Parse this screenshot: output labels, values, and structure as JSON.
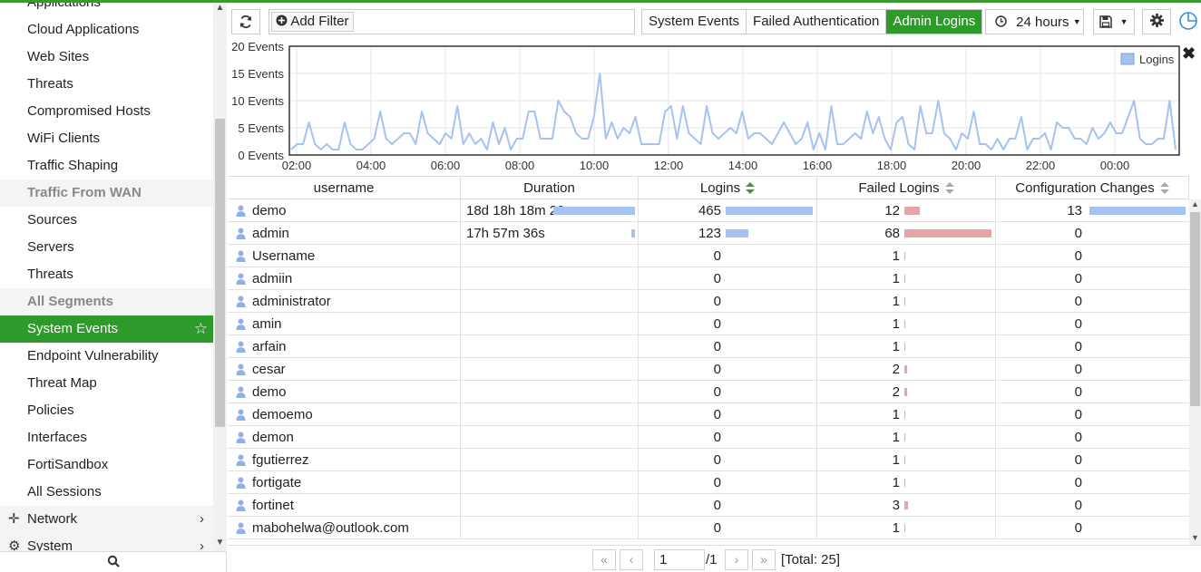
{
  "sidebar": {
    "items": [
      {
        "label": "Applications",
        "type": "item"
      },
      {
        "label": "Cloud Applications",
        "type": "item"
      },
      {
        "label": "Web Sites",
        "type": "item"
      },
      {
        "label": "Threats",
        "type": "item"
      },
      {
        "label": "Compromised Hosts",
        "type": "item"
      },
      {
        "label": "WiFi Clients",
        "type": "item"
      },
      {
        "label": "Traffic Shaping",
        "type": "item"
      },
      {
        "label": "Traffic From WAN",
        "type": "header"
      },
      {
        "label": "Sources",
        "type": "item"
      },
      {
        "label": "Servers",
        "type": "item"
      },
      {
        "label": "Threats",
        "type": "item"
      },
      {
        "label": "All Segments",
        "type": "header"
      },
      {
        "label": "System Events",
        "type": "active"
      },
      {
        "label": "Endpoint Vulnerability",
        "type": "item"
      },
      {
        "label": "Threat Map",
        "type": "item"
      },
      {
        "label": "Policies",
        "type": "item"
      },
      {
        "label": "Interfaces",
        "type": "item"
      },
      {
        "label": "FortiSandbox",
        "type": "item"
      },
      {
        "label": "All Sessions",
        "type": "item"
      }
    ],
    "network_label": "Network",
    "system_label": "System"
  },
  "toolbar": {
    "add_filter_label": "Add Filter",
    "segments": [
      {
        "label": "System Events",
        "active": false
      },
      {
        "label": "Failed Authentication",
        "active": false
      },
      {
        "label": "Admin Logins",
        "active": true
      }
    ],
    "time_range": "24 hours"
  },
  "chart_data": {
    "type": "line",
    "ylim": [
      0,
      20
    ],
    "y_ticks": [
      "0 Events",
      "5 Events",
      "10 Events",
      "15 Events",
      "20 Events"
    ],
    "x_ticks": [
      "02:00",
      "04:00",
      "06:00",
      "08:00",
      "10:00",
      "12:00",
      "14:00",
      "16:00",
      "18:00",
      "20:00",
      "22:00",
      "00:00"
    ],
    "legend": "Logins",
    "legend_position": "top-right",
    "color": "#a6c2f0",
    "series": [
      {
        "name": "Logins",
        "values": [
          1,
          2,
          2,
          6,
          2,
          1,
          2,
          1,
          1,
          6,
          2,
          1,
          1,
          2,
          3,
          8,
          3,
          2,
          3,
          4,
          4,
          2,
          8,
          4,
          3,
          2,
          4,
          3,
          9,
          2,
          4,
          2,
          3,
          1,
          6,
          2,
          5,
          1,
          3,
          3,
          8,
          8,
          3,
          3,
          3,
          10,
          8,
          7,
          4,
          3,
          3,
          7,
          15,
          3,
          6,
          3,
          5,
          4,
          7,
          2,
          2,
          2,
          2,
          8,
          9,
          3,
          9,
          4,
          3,
          2,
          9,
          4,
          3,
          4,
          5,
          4,
          8,
          3,
          4,
          4,
          3,
          2,
          4,
          6,
          4,
          2,
          3,
          6,
          1,
          4,
          1,
          9,
          2,
          2,
          3,
          4,
          3,
          8,
          4,
          7,
          3,
          1,
          6,
          7,
          2,
          1,
          9,
          4,
          4,
          10,
          4,
          3,
          1,
          4,
          3,
          8,
          2,
          2,
          1,
          3,
          1,
          3,
          3,
          7,
          1,
          3,
          3,
          4,
          1,
          6,
          5,
          5,
          3,
          3,
          2,
          5,
          3,
          4,
          6,
          4,
          4,
          7,
          10,
          3,
          2,
          2,
          3,
          3,
          10,
          1
        ]
      }
    ]
  },
  "table": {
    "columns": [
      "username",
      "Duration",
      "Logins",
      "Failed Logins",
      "Configuration Changes"
    ],
    "sorted_column": "Logins",
    "rows": [
      {
        "username": "demo",
        "duration": "18d 18h 18m 20s",
        "duration_frac": 1.0,
        "logins": "465",
        "logins_frac": 1.0,
        "failed": "12",
        "failed_frac": 0.18,
        "config": "13",
        "config_frac": 1.0
      },
      {
        "username": "admin",
        "duration": "17h 57m 36s",
        "duration_frac": 0.04,
        "logins": "123",
        "logins_frac": 0.26,
        "failed": "68",
        "failed_frac": 1.0,
        "config": "0",
        "config_frac": 0
      },
      {
        "username": "Username",
        "duration": "",
        "duration_frac": 0,
        "logins": "0",
        "logins_frac": 0,
        "failed": "1",
        "failed_frac": 0.015,
        "config": "0",
        "config_frac": 0
      },
      {
        "username": "admiin",
        "duration": "",
        "duration_frac": 0,
        "logins": "0",
        "logins_frac": 0,
        "failed": "1",
        "failed_frac": 0.015,
        "config": "0",
        "config_frac": 0
      },
      {
        "username": "administrator",
        "duration": "",
        "duration_frac": 0,
        "logins": "0",
        "logins_frac": 0,
        "failed": "1",
        "failed_frac": 0.015,
        "config": "0",
        "config_frac": 0
      },
      {
        "username": "amin",
        "duration": "",
        "duration_frac": 0,
        "logins": "0",
        "logins_frac": 0,
        "failed": "1",
        "failed_frac": 0.015,
        "config": "0",
        "config_frac": 0
      },
      {
        "username": "arfain",
        "duration": "",
        "duration_frac": 0,
        "logins": "0",
        "logins_frac": 0,
        "failed": "1",
        "failed_frac": 0.015,
        "config": "0",
        "config_frac": 0
      },
      {
        "username": "cesar",
        "duration": "",
        "duration_frac": 0,
        "logins": "0",
        "logins_frac": 0,
        "failed": "2",
        "failed_frac": 0.03,
        "config": "0",
        "config_frac": 0
      },
      {
        "username": "demo",
        "duration": "",
        "duration_frac": 0,
        "logins": "0",
        "logins_frac": 0,
        "failed": "2",
        "failed_frac": 0.03,
        "config": "0",
        "config_frac": 0
      },
      {
        "username": "demoemo",
        "duration": "",
        "duration_frac": 0,
        "logins": "0",
        "logins_frac": 0,
        "failed": "1",
        "failed_frac": 0.015,
        "config": "0",
        "config_frac": 0
      },
      {
        "username": "demon",
        "duration": "",
        "duration_frac": 0,
        "logins": "0",
        "logins_frac": 0,
        "failed": "1",
        "failed_frac": 0.015,
        "config": "0",
        "config_frac": 0
      },
      {
        "username": "fgutierrez",
        "duration": "",
        "duration_frac": 0,
        "logins": "0",
        "logins_frac": 0,
        "failed": "1",
        "failed_frac": 0.015,
        "config": "0",
        "config_frac": 0
      },
      {
        "username": "fortigate",
        "duration": "",
        "duration_frac": 0,
        "logins": "0",
        "logins_frac": 0,
        "failed": "1",
        "failed_frac": 0.015,
        "config": "0",
        "config_frac": 0
      },
      {
        "username": "fortinet",
        "duration": "",
        "duration_frac": 0,
        "logins": "0",
        "logins_frac": 0,
        "failed": "3",
        "failed_frac": 0.045,
        "config": "0",
        "config_frac": 0
      },
      {
        "username": "mabohelwa@outlook.com",
        "duration": "",
        "duration_frac": 0,
        "logins": "0",
        "logins_frac": 0,
        "failed": "1",
        "failed_frac": 0.015,
        "config": "0",
        "config_frac": 0
      }
    ]
  },
  "pager": {
    "current_page": "1",
    "page_count": "/1",
    "total": "[Total: 25]"
  }
}
